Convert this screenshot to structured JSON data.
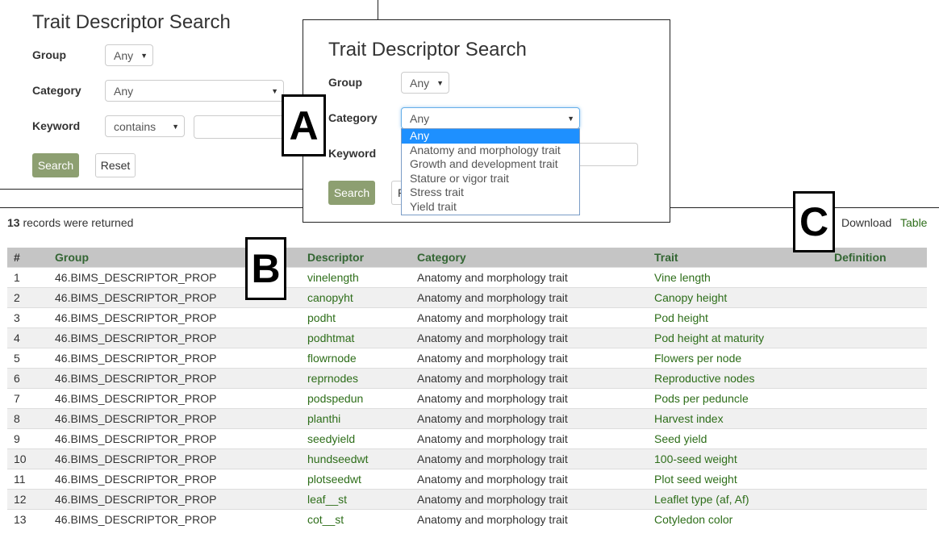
{
  "form_back": {
    "title": "Trait Descriptor Search",
    "group_label": "Group",
    "group_value": "Any",
    "category_label": "Category",
    "category_value": "Any",
    "keyword_label": "Keyword",
    "keyword_op": "contains",
    "search_label": "Search",
    "reset_label": "Reset"
  },
  "form_front": {
    "title": "Trait Descriptor Search",
    "group_label": "Group",
    "group_value": "Any",
    "category_label": "Category",
    "category_value": "Any",
    "keyword_label": "Keyword",
    "search_label": "Search",
    "reset_partial": "R",
    "category_options": [
      "Any",
      "Anatomy and morphology trait",
      "Growth and development trait",
      "Stature or vigor trait",
      "Stress trait",
      "Yield trait"
    ]
  },
  "callouts": {
    "a": "A",
    "b": "B",
    "c": "C"
  },
  "results": {
    "count": "13",
    "count_suffix": " records were returned",
    "download_label": "Download",
    "table_label": "Table",
    "columns": [
      "#",
      "Group",
      "Descriptor",
      "Category",
      "Trait",
      "Definition"
    ],
    "rows": [
      [
        "1",
        "46.BIMS_DESCRIPTOR_PROP",
        "vinelength",
        "Anatomy and morphology trait",
        "Vine length",
        ""
      ],
      [
        "2",
        "46.BIMS_DESCRIPTOR_PROP",
        "canopyht",
        "Anatomy and morphology trait",
        "Canopy height",
        ""
      ],
      [
        "3",
        "46.BIMS_DESCRIPTOR_PROP",
        "podht",
        "Anatomy and morphology trait",
        "Pod height",
        ""
      ],
      [
        "4",
        "46.BIMS_DESCRIPTOR_PROP",
        "podhtmat",
        "Anatomy and morphology trait",
        "Pod height at maturity",
        ""
      ],
      [
        "5",
        "46.BIMS_DESCRIPTOR_PROP",
        "flowrnode",
        "Anatomy and morphology trait",
        "Flowers per node",
        ""
      ],
      [
        "6",
        "46.BIMS_DESCRIPTOR_PROP",
        "reprnodes",
        "Anatomy and morphology trait",
        "Reproductive nodes",
        ""
      ],
      [
        "7",
        "46.BIMS_DESCRIPTOR_PROP",
        "podspedun",
        "Anatomy and morphology trait",
        "Pods per peduncle",
        ""
      ],
      [
        "8",
        "46.BIMS_DESCRIPTOR_PROP",
        "planthi",
        "Anatomy and morphology trait",
        "Harvest index",
        ""
      ],
      [
        "9",
        "46.BIMS_DESCRIPTOR_PROP",
        "seedyield",
        "Anatomy and morphology trait",
        "Seed yield",
        ""
      ],
      [
        "10",
        "46.BIMS_DESCRIPTOR_PROP",
        "hundseedwt",
        "Anatomy and morphology trait",
        "100-seed weight",
        ""
      ],
      [
        "11",
        "46.BIMS_DESCRIPTOR_PROP",
        "plotseedwt",
        "Anatomy and morphology trait",
        "Plot seed weight",
        ""
      ],
      [
        "12",
        "46.BIMS_DESCRIPTOR_PROP",
        "leaf__st",
        "Anatomy and morphology trait",
        "Leaflet type (af, Af)",
        ""
      ],
      [
        "13",
        "46.BIMS_DESCRIPTOR_PROP",
        "cot__st",
        "Anatomy and morphology trait",
        "Cotyledon color",
        ""
      ]
    ]
  },
  "colors": {
    "header_text": "#336633",
    "link_green": "#2e6e1a",
    "search_button": "#8d9f71",
    "table_header_bg": "#c5c5c5"
  }
}
